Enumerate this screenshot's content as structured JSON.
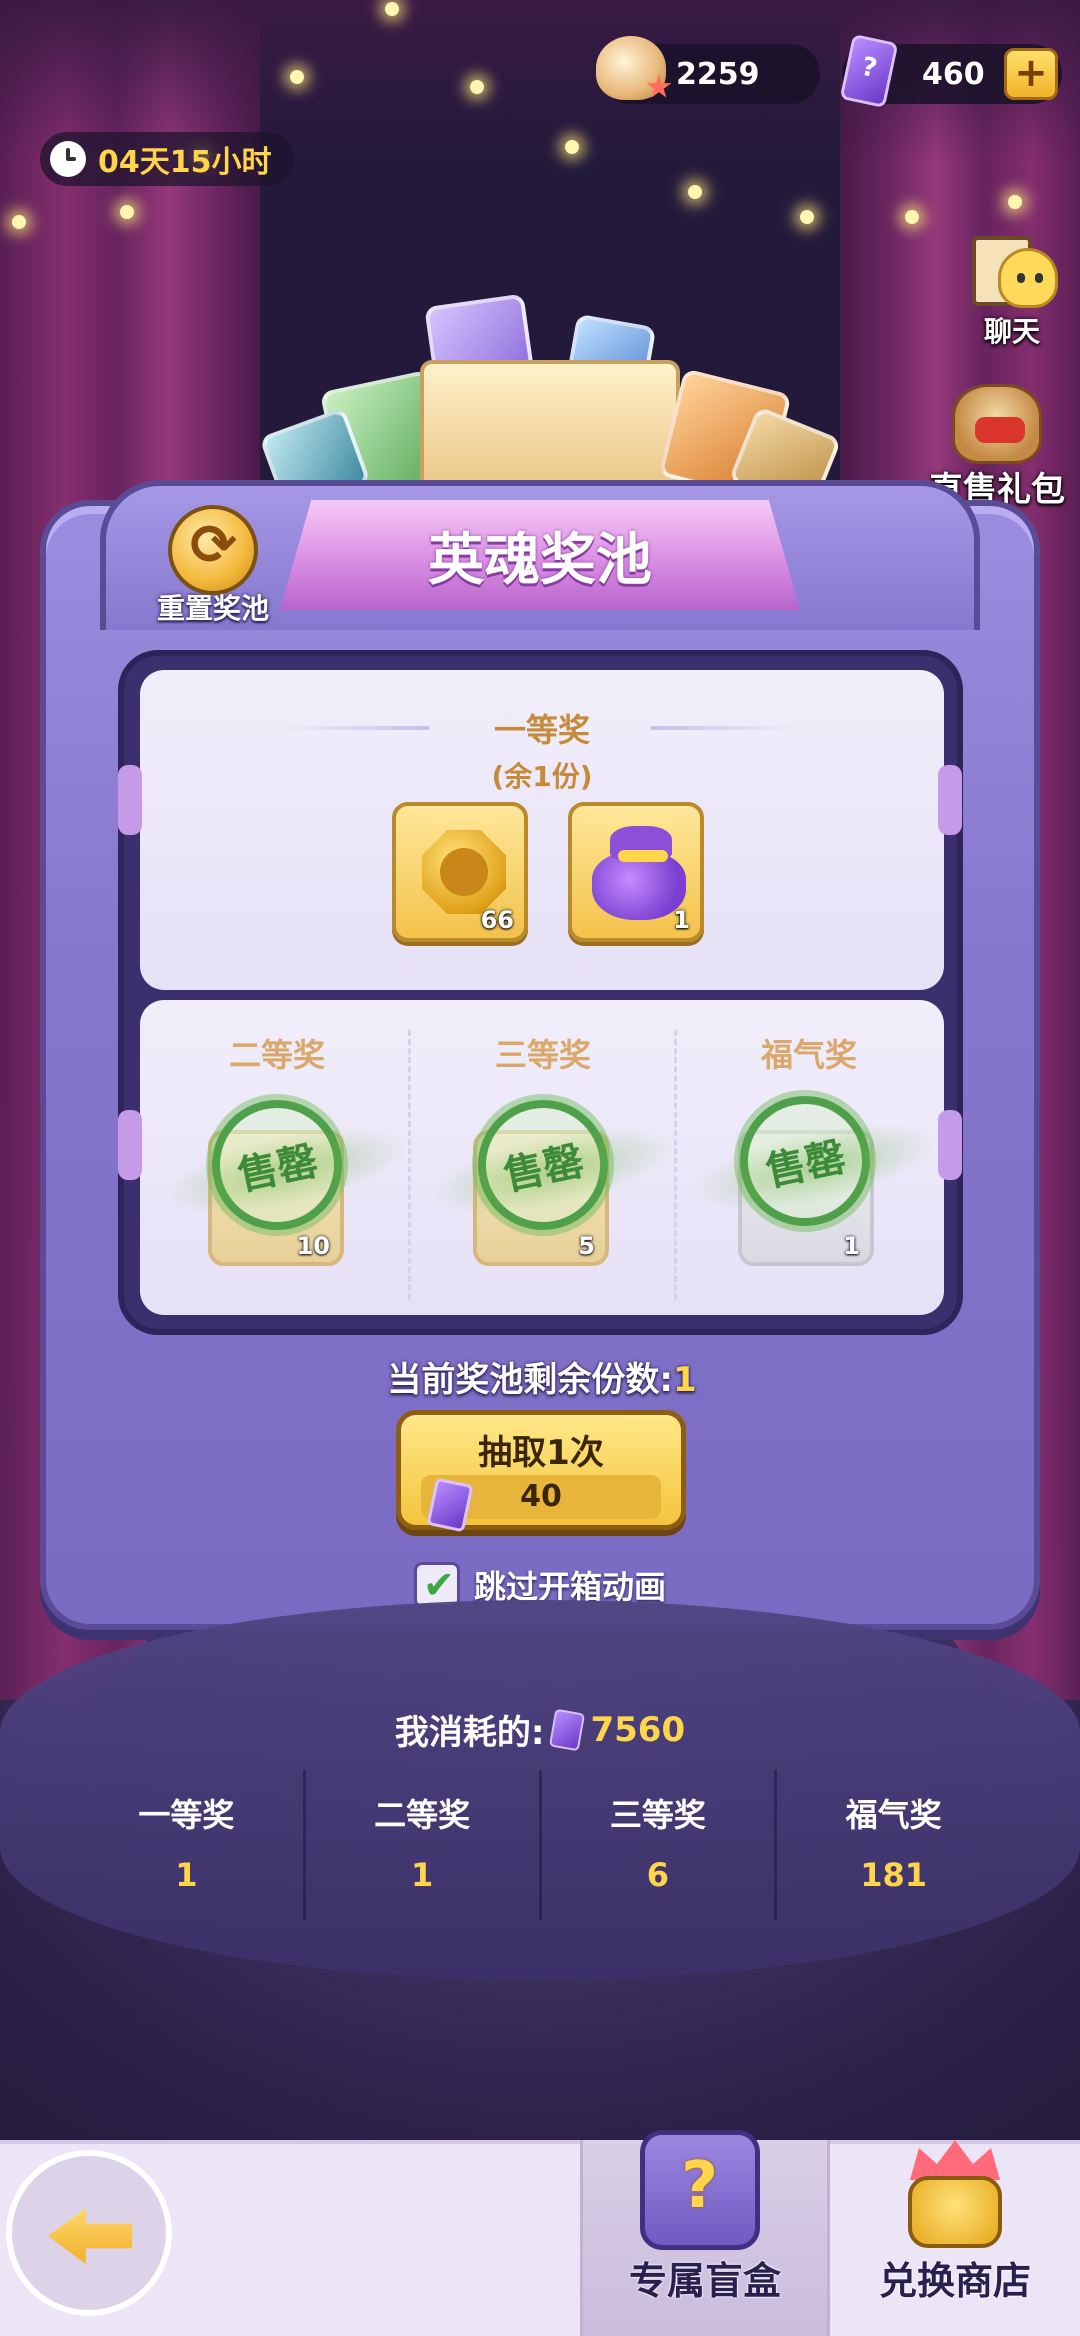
{
  "topbar": {
    "timer": "04天15小时",
    "shells": "2259",
    "tickets": "460",
    "plus": "+"
  },
  "side": {
    "chat_label": "聊天",
    "gift_label": "直售礼包"
  },
  "pool": {
    "title": "英魂奖池",
    "reset_label": "重置奖池",
    "first_prize": {
      "title": "一等奖",
      "remaining": "(余1份)",
      "items": [
        {
          "icon": "gold-coin-icon",
          "qty": "66"
        },
        {
          "icon": "purple-bag-icon",
          "qty": "1"
        }
      ]
    },
    "other_prizes": [
      {
        "title": "二等奖",
        "status": "售罄",
        "qty": "10"
      },
      {
        "title": "三等奖",
        "status": "售罄",
        "qty": "5"
      },
      {
        "title": "福气奖",
        "status": "售罄",
        "qty": "1"
      }
    ],
    "remain_label": "当前奖池剩余份数:",
    "remain_value": "1",
    "draw_label": "抽取1次",
    "draw_cost": "40",
    "skip_label": "跳过开箱动画",
    "skip_checked": true
  },
  "stats": {
    "consumed_label": "我消耗的:",
    "consumed_value": "7560",
    "items": [
      {
        "label": "一等奖",
        "value": "1"
      },
      {
        "label": "二等奖",
        "value": "1"
      },
      {
        "label": "三等奖",
        "value": "6"
      },
      {
        "label": "福气奖",
        "value": "181"
      }
    ]
  },
  "bottom_nav": {
    "blind_box": "专属盲盒",
    "shop": "兑换商店"
  },
  "colors": {
    "accent_gold": "#ffd54a",
    "sold_green": "#4fa04a",
    "machine_purple": "#8677cd"
  }
}
